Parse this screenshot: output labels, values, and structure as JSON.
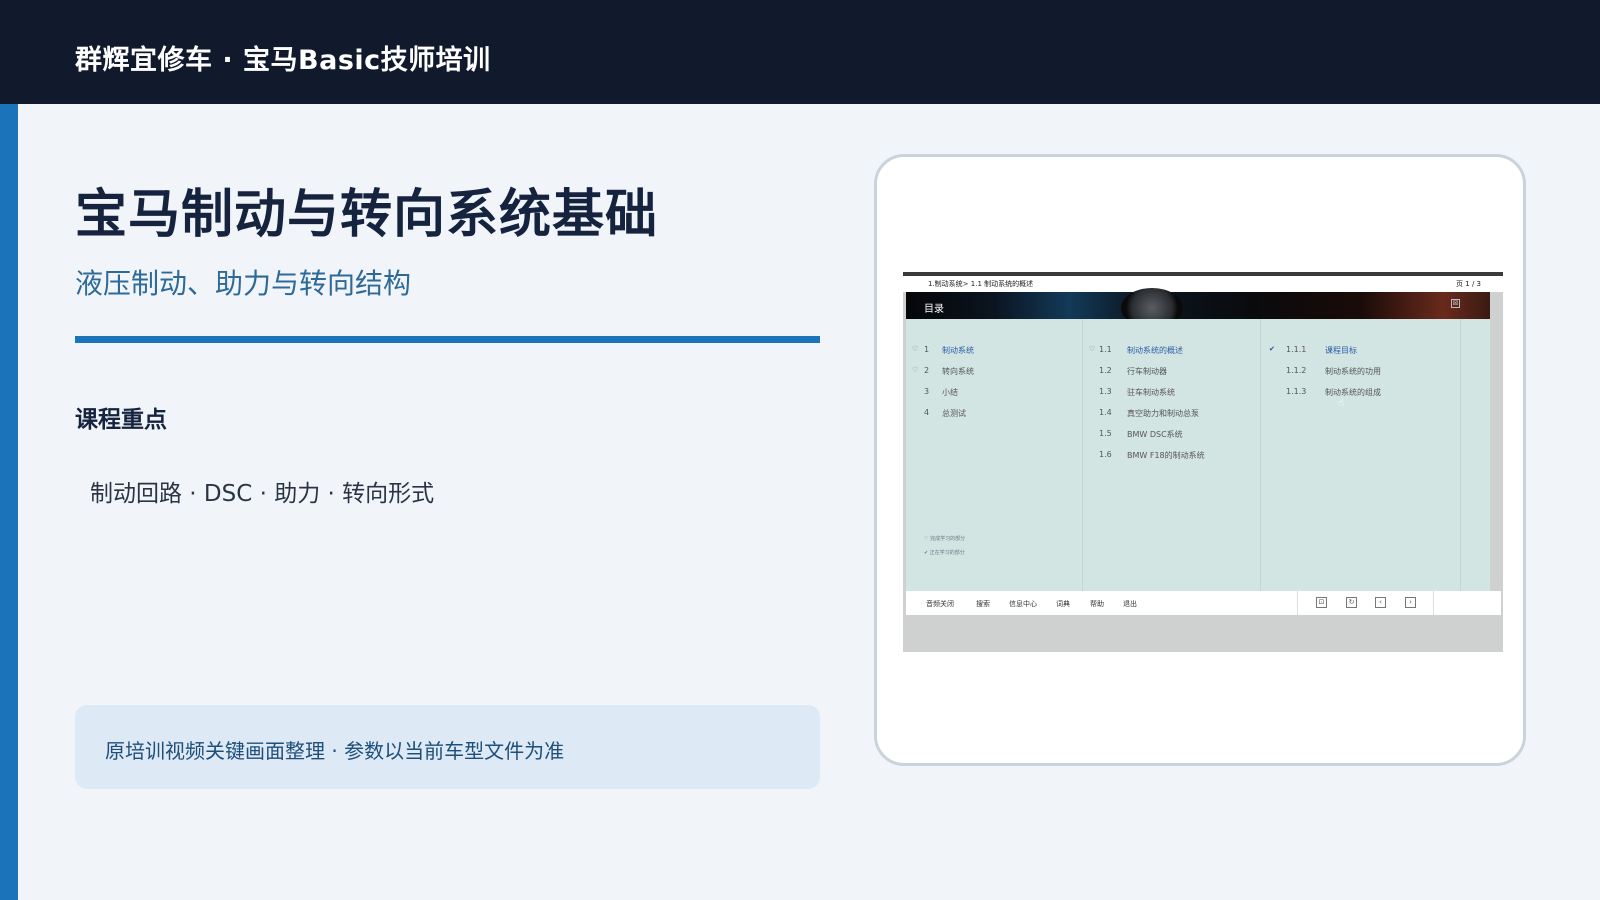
{
  "header": {
    "brand": "群辉宜修车 · 宝马Basic技师培训"
  },
  "main": {
    "title": "宝马制动与转向系统基础",
    "subtitle": "液压制动、助力与转向结构",
    "section_title": "课程重点",
    "keypoints": "制动回路 · DSC · 助力 · 转向形式",
    "note": "原培训视频关键画面整理 · 参数以当前车型文件为准"
  },
  "screenshot": {
    "breadcrumb": "1.制动系统> 1.1 制动系统的概述",
    "page": "页  1 / 3",
    "toc_label": "目录",
    "close_glyph": "⊠",
    "col1": [
      {
        "check": "♡",
        "num": "1",
        "label": "制动系统",
        "active": true
      },
      {
        "check": "♡",
        "num": "2",
        "label": "转向系统",
        "active": false
      },
      {
        "check": "",
        "num": "3",
        "label": "小结",
        "active": false
      },
      {
        "check": "",
        "num": "4",
        "label": "总测试",
        "active": false
      }
    ],
    "col2": [
      {
        "check": "♡",
        "num": "1.1",
        "label": "制动系统的概述",
        "active": true
      },
      {
        "check": "",
        "num": "1.2",
        "label": "行车制动器",
        "active": false
      },
      {
        "check": "",
        "num": "1.3",
        "label": "驻车制动系统",
        "active": false
      },
      {
        "check": "",
        "num": "1.4",
        "label": "真空助力和制动总泵",
        "active": false
      },
      {
        "check": "",
        "num": "1.5",
        "label": "BMW DSC系统",
        "active": false
      },
      {
        "check": "",
        "num": "1.6",
        "label": "BMW F18的制动系统",
        "active": false
      }
    ],
    "col3": [
      {
        "check": "✔",
        "num": "1.1.1",
        "label": "课程目标",
        "active": true
      },
      {
        "check": "",
        "num": "1.1.2",
        "label": "制动系统的功用",
        "active": false
      },
      {
        "check": "",
        "num": "1.1.3",
        "label": "制动系统的组成",
        "active": false
      }
    ],
    "legend": [
      "♡ 完成学习的部分",
      "✔ 正在学习的部分"
    ],
    "footer": [
      "音频关闭",
      "搜索",
      "信息中心",
      "词典",
      "帮助",
      "退出"
    ],
    "nav_buttons": [
      "⊡",
      "↻",
      "‹",
      "›"
    ]
  }
}
